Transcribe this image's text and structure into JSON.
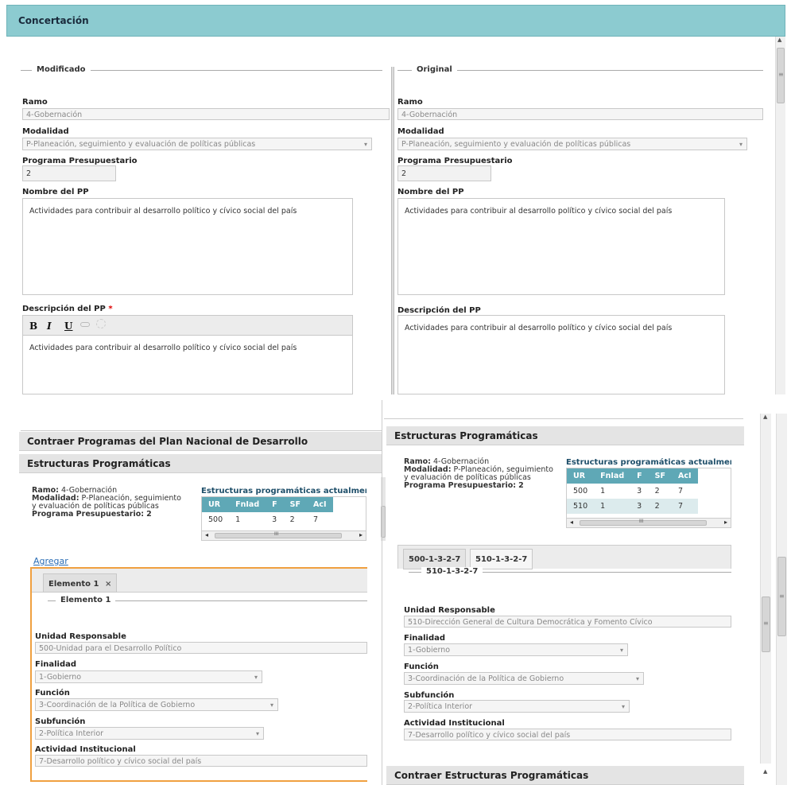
{
  "header": {
    "title": "Concertación"
  },
  "top": {
    "left": {
      "legend": "Modificado",
      "ramo_label": "Ramo",
      "ramo_value": "4-Gobernación",
      "modalidad_label": "Modalidad",
      "modalidad_value": "P-Planeación, seguimiento y evaluación de políticas públicas",
      "programa_label": "Programa Presupuestario",
      "programa_value": "2",
      "nombre_label": "Nombre del PP",
      "nombre_value": "Actividades para contribuir al desarrollo político y cívico social del país",
      "descripcion_label": "Descripción del PP",
      "required_mark": "*",
      "descripcion_value": "Actividades para contribuir al desarrollo político y cívico social del país",
      "toolbar": {
        "bold": "B",
        "italic": "I",
        "underline": "U"
      }
    },
    "right": {
      "legend": "Original",
      "ramo_label": "Ramo",
      "ramo_value": "4-Gobernación",
      "modalidad_label": "Modalidad",
      "modalidad_value": "P-Planeación, seguimiento y evaluación de políticas públicas",
      "programa_label": "Programa Presupuestario",
      "programa_value": "2",
      "nombre_label": "Nombre del PP",
      "nombre_value": "Actividades para contribuir al desarrollo político y cívico social del país",
      "descripcion_label": "Descripción del PP",
      "descripcion_value": "Actividades para contribuir al desarrollo político y cívico social del país"
    }
  },
  "bottom": {
    "left": {
      "contraer_pnd": "Contraer Programas del Plan Nacional de Desarrollo",
      "section_title": "Estructuras Programáticas",
      "info": {
        "ramo_label": "Ramo:",
        "ramo_value": "4-Gobernación",
        "modalidad_label": "Modalidad:",
        "modalidad_value_1": "P-Planeación, seguimiento",
        "modalidad_value_2": "y evaluación de políticas públicas",
        "programa_label": "Programa Presupuestario:",
        "programa_value": "2"
      },
      "table_title": "Estructuras programáticas actualment",
      "columns": [
        "UR",
        "FnIad",
        "F",
        "SF",
        "AcI"
      ],
      "rows": [
        [
          "500",
          "1",
          "3",
          "2",
          "7"
        ]
      ],
      "agregar": "Agregar",
      "tab_label": "Elemento 1",
      "legend": "Elemento 1",
      "ur_label": "Unidad Responsable",
      "ur_value": "500-Unidad para el Desarrollo Político",
      "finalidad_label": "Finalidad",
      "finalidad_value": "1-Gobierno",
      "funcion_label": "Función",
      "funcion_value": "3-Coordinación de la Política de Gobierno",
      "subfuncion_label": "Subfunción",
      "subfuncion_value": "2-Política Interior",
      "actividad_label": "Actividad Institucional",
      "actividad_value": "7-Desarrollo político y cívico social del país"
    },
    "right": {
      "section_title": "Estructuras Programáticas",
      "info": {
        "ramo_label": "Ramo:",
        "ramo_value": "4-Gobernación",
        "modalidad_label": "Modalidad:",
        "modalidad_value_1": "P-Planeación, seguimiento",
        "modalidad_value_2": "y evaluación de políticas públicas",
        "programa_label": "Programa Presupuestario:",
        "programa_value": "2"
      },
      "table_title": "Estructuras programáticas actualmen",
      "columns": [
        "UR",
        "FnIad",
        "F",
        "SF",
        "AcI"
      ],
      "rows": [
        [
          "500",
          "1",
          "3",
          "2",
          "7"
        ],
        [
          "510",
          "1",
          "3",
          "2",
          "7"
        ]
      ],
      "tabs": [
        "500-1-3-2-7",
        "510-1-3-2-7"
      ],
      "legend": "510-1-3-2-7",
      "ur_label": "Unidad Responsable",
      "ur_value": "510-Dirección General de Cultura Democrática y Fomento Cívico",
      "finalidad_label": "Finalidad",
      "finalidad_value": "1-Gobierno",
      "funcion_label": "Función",
      "funcion_value": "3-Coordinación de la Política de Gobierno",
      "subfuncion_label": "Subfunción",
      "subfuncion_value": "2-Política Interior",
      "actividad_label": "Actividad Institucional",
      "actividad_value": "7-Desarrollo político y cívico social del país",
      "contraer": "Contraer Estructuras Programáticas"
    }
  },
  "icons": {
    "dropdown": "▾",
    "close": "×",
    "scroll_up": "▲",
    "scroll_left": "◂",
    "scroll_right": "▸",
    "grip": "≡",
    "grip_h": "III"
  }
}
